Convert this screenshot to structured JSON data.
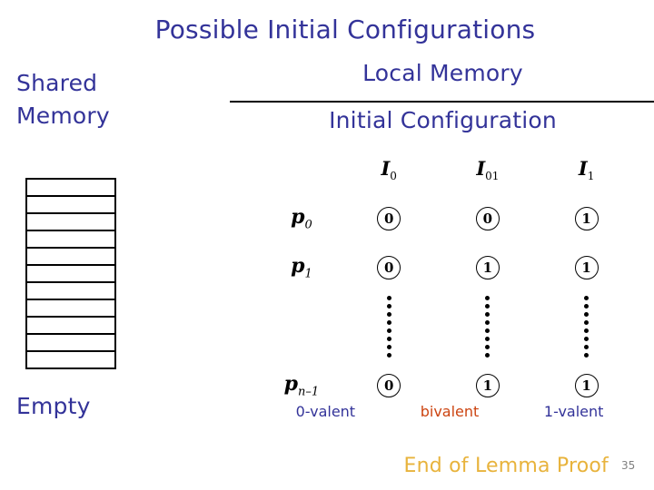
{
  "slide": {
    "title": "Possible Initial Configurations",
    "page_number": "35",
    "footer_note": "End of Lemma Proof",
    "colors": {
      "heading_blue": "#333399",
      "bivalent_orange": "#cc4411",
      "footer_gold": "#e8b33c",
      "page_number_gray": "#808080",
      "rule_black": "#000000"
    }
  },
  "shared_memory": {
    "heading_line1": "Shared",
    "heading_line2": "Memory",
    "empty_label": "Empty",
    "cell_count": 11,
    "cells": [
      "",
      "",
      "",
      "",
      "",
      "",
      "",
      "",
      "",
      "",
      ""
    ]
  },
  "local_memory": {
    "heading": "Local Memory",
    "subheading": "Initial Configuration",
    "columns": [
      {
        "name": "I",
        "subscript": "0",
        "valency": "0-valent",
        "valency_color": "#333399"
      },
      {
        "name": "I",
        "subscript": "01",
        "valency": "bivalent",
        "valency_color": "#cc4411"
      },
      {
        "name": "I",
        "subscript": "1",
        "valency": "1-valent",
        "valency_color": "#333399"
      }
    ],
    "rows": [
      {
        "process": "p",
        "subscript": "0",
        "bits": [
          "0",
          "0",
          "1"
        ]
      },
      {
        "process": "p",
        "subscript": "1",
        "bits": [
          "0",
          "1",
          "1"
        ]
      },
      {
        "process": "",
        "subscript": "",
        "bits": [
          "⋮",
          "⋮",
          "⋮"
        ],
        "is_ellipsis": true
      },
      {
        "process": "p",
        "subscript": "n–1",
        "bits": [
          "0",
          "1",
          "1"
        ]
      }
    ],
    "ellipsis_dot_count": 8
  }
}
